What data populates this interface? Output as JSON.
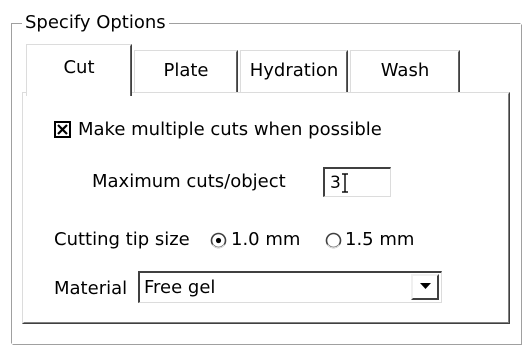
{
  "group": {
    "title": "Specify Options"
  },
  "tabs": [
    {
      "label": "Cut",
      "selected": true
    },
    {
      "label": "Plate",
      "selected": false
    },
    {
      "label": "Hydration",
      "selected": false
    },
    {
      "label": "Wash",
      "selected": false
    }
  ],
  "cut": {
    "multiple_cuts": {
      "label": "Make multiple cuts when possible",
      "checked": true
    },
    "max_cuts": {
      "label": "Maximum cuts/object",
      "value": "3"
    },
    "tip_size": {
      "label": "Cutting tip size",
      "options": [
        "1.0 mm",
        "1.5 mm"
      ],
      "selected": "1.0 mm"
    },
    "material": {
      "label": "Material",
      "value": "Free gel"
    }
  },
  "icons": {
    "checkbox_mark": "x-check-icon",
    "dropdown": "chevron-down-icon",
    "text_cursor": "i-beam-cursor-icon"
  }
}
